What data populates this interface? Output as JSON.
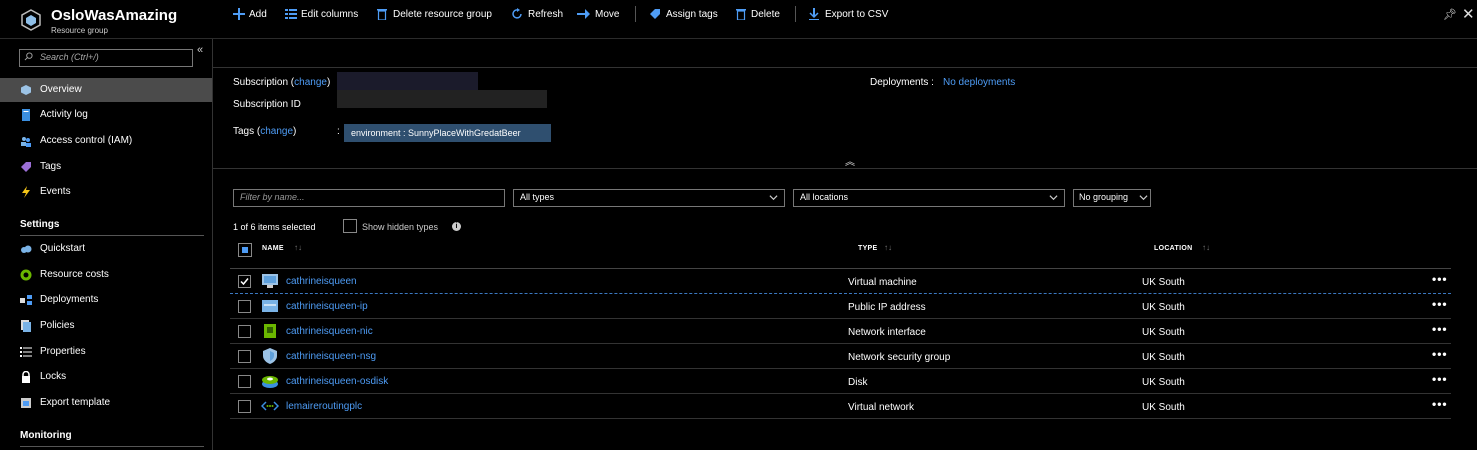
{
  "app": {
    "title": "OsloWasAmazing",
    "subtitle": "Resource group",
    "icons": {
      "app": "resource-group-cube-icon",
      "pin": "pin-icon",
      "close": "close-icon"
    }
  },
  "sidebar": {
    "search_placeholder": "Search (Ctrl+/)",
    "items": [
      {
        "label": "Overview",
        "icon": "cube-icon",
        "active": true
      },
      {
        "label": "Activity log",
        "icon": "document-icon"
      },
      {
        "label": "Access control (IAM)",
        "icon": "people-icon"
      },
      {
        "label": "Tags",
        "icon": "tag-icon"
      },
      {
        "label": "Events",
        "icon": "lightning-icon"
      }
    ],
    "settings_heading": "Settings",
    "settings_items": [
      {
        "label": "Quickstart",
        "icon": "cloud-icon"
      },
      {
        "label": "Resource costs",
        "icon": "cost-circle-icon"
      },
      {
        "label": "Deployments",
        "icon": "deployments-icon"
      },
      {
        "label": "Policies",
        "icon": "policies-icon"
      },
      {
        "label": "Properties",
        "icon": "list-icon"
      },
      {
        "label": "Locks",
        "icon": "lock-icon"
      },
      {
        "label": "Export template",
        "icon": "export-template-icon"
      }
    ],
    "monitoring_heading": "Monitoring"
  },
  "toolbar": {
    "add": "Add",
    "edit_columns": "Edit columns",
    "delete_rg": "Delete resource group",
    "refresh": "Refresh",
    "move": "Move",
    "assign_tags": "Assign tags",
    "delete": "Delete",
    "export_csv": "Export to CSV"
  },
  "essentials": {
    "subscription_label": "Subscription",
    "change": "change",
    "subscription_id_label": "Subscription ID",
    "tags_label": "Tags",
    "tag_value": "environment : SunnyPlaceWithGredatBeer",
    "deployments_label": "Deployments",
    "deployments_value": "No deployments"
  },
  "filters": {
    "name_placeholder": "Filter by name...",
    "types": "All types",
    "locations": "All locations",
    "grouping": "No grouping"
  },
  "list": {
    "items_count": "1 of 6 items selected",
    "show_hidden": "Show hidden types",
    "columns": {
      "name": "NAME",
      "type": "TYPE",
      "location": "LOCATION"
    },
    "rows": [
      {
        "name": "cathrineisqueen",
        "type": "Virtual machine",
        "location": "UK South",
        "icon": "virtual-machine-icon",
        "selected": true
      },
      {
        "name": "cathrineisqueen-ip",
        "type": "Public IP address",
        "location": "UK South",
        "icon": "public-ip-icon",
        "selected": false
      },
      {
        "name": "cathrineisqueen-nic",
        "type": "Network interface",
        "location": "UK South",
        "icon": "network-interface-icon",
        "selected": false
      },
      {
        "name": "cathrineisqueen-nsg",
        "type": "Network security group",
        "location": "UK South",
        "icon": "shield-icon",
        "selected": false
      },
      {
        "name": "cathrineisqueen-osdisk",
        "type": "Disk",
        "location": "UK South",
        "icon": "disk-icon",
        "selected": false
      },
      {
        "name": "lemaireroutingplc",
        "type": "Virtual network",
        "location": "UK South",
        "icon": "virtual-network-icon",
        "selected": false
      }
    ],
    "more": "•••"
  }
}
